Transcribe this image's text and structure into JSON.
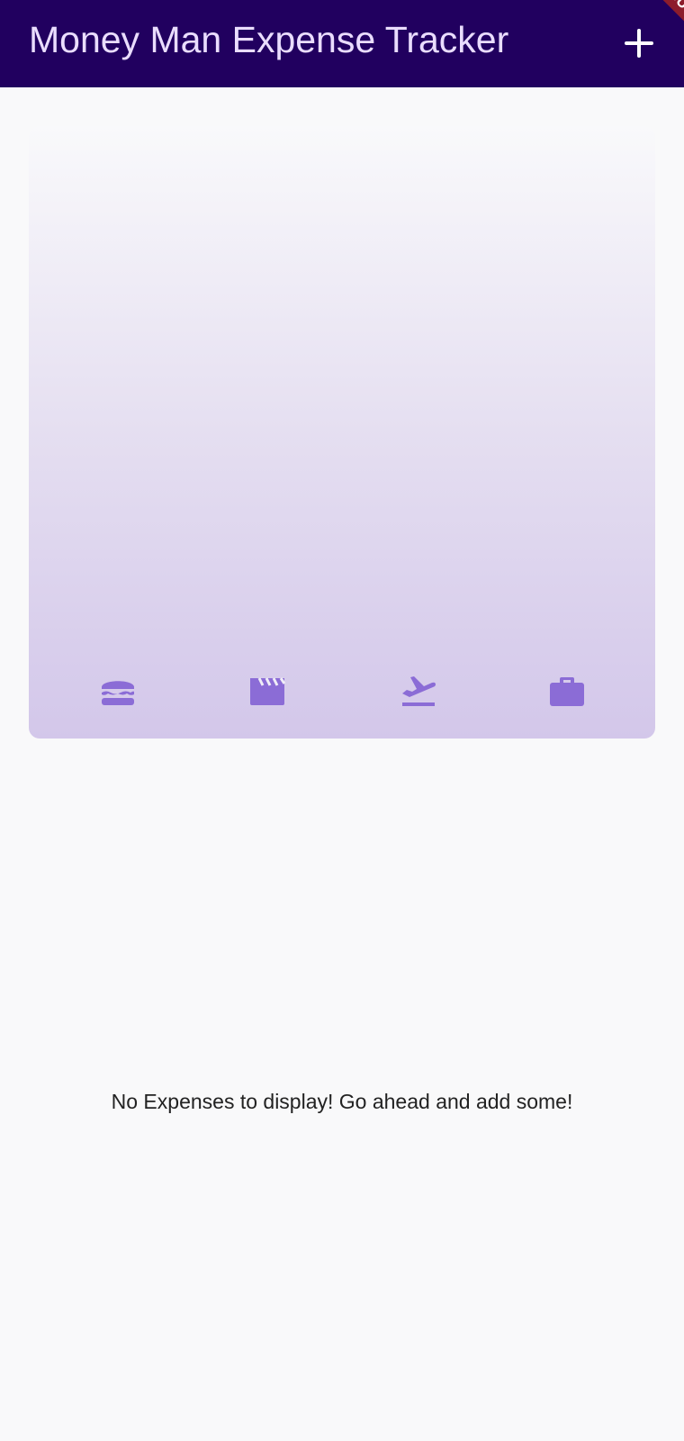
{
  "app_bar": {
    "title": "Money Man Expense Tracker",
    "add_icon": "plus-icon",
    "background_color": "#21005f",
    "title_color": "#eaddff"
  },
  "debug_banner": {
    "label": "DEBUG"
  },
  "chart": {
    "bar_values": [
      0,
      0,
      0,
      0
    ],
    "categories": [
      {
        "icon": "burger-icon"
      },
      {
        "icon": "movie-clapper-icon"
      },
      {
        "icon": "flight-takeoff-icon"
      },
      {
        "icon": "briefcase-icon"
      }
    ],
    "gradient_top": "#f9f9fb",
    "gradient_bottom": "#d3c7ea",
    "icon_color": "#8b6cd6"
  },
  "expenses": {
    "empty_message": "No Expenses to display! Go ahead and add some!"
  }
}
